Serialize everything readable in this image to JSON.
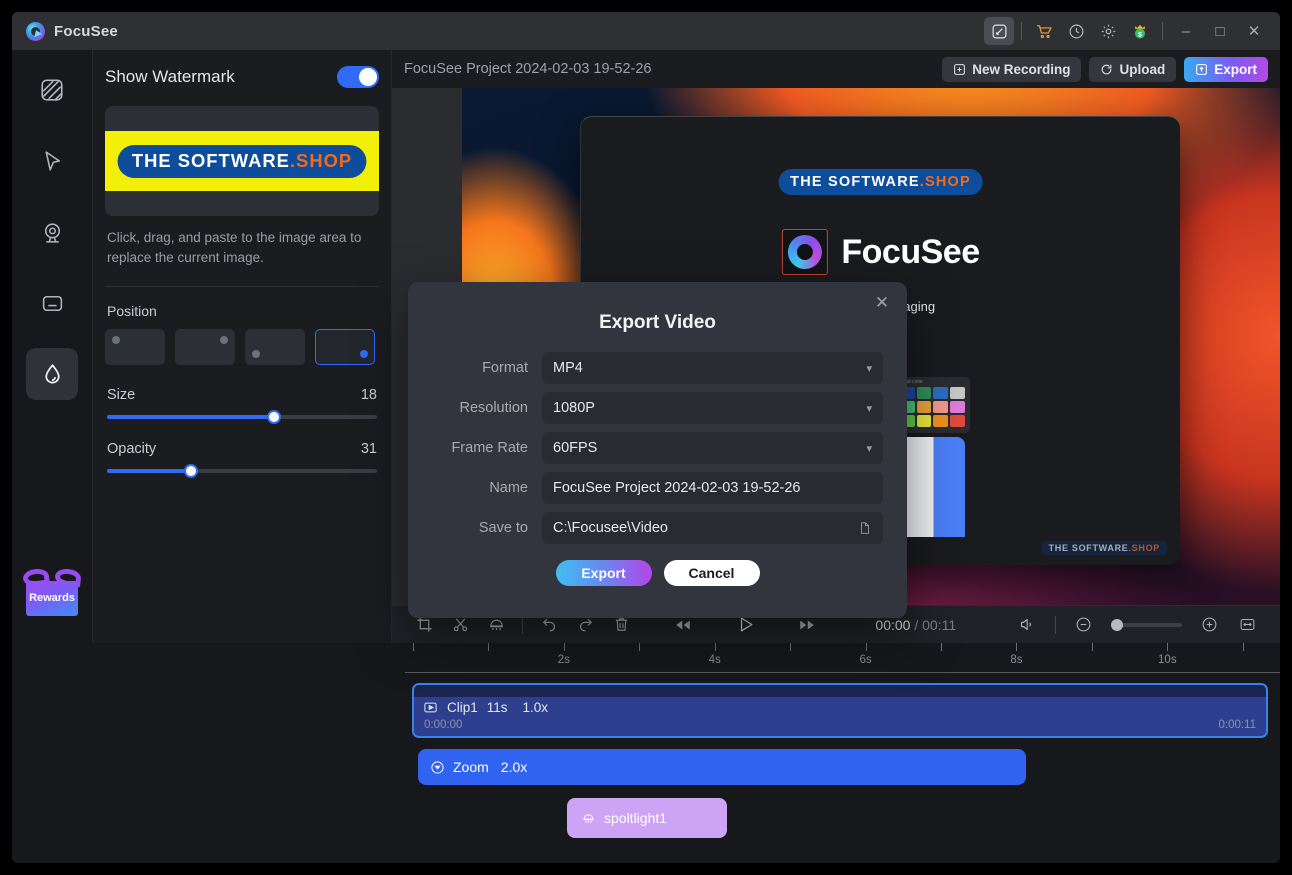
{
  "titlebar": {
    "app_name": "FocuSee",
    "icons": [
      "pen-edit-icon",
      "cart-icon",
      "clock-icon",
      "gear-icon",
      "crown-dollar-icon"
    ],
    "window_controls": {
      "minimize": "–",
      "maximize": "□",
      "close": "✕"
    }
  },
  "rail": {
    "items": [
      {
        "name": "background",
        "icon": "background-pattern-icon",
        "active": false
      },
      {
        "name": "cursor",
        "icon": "cursor-arrow-icon",
        "active": false
      },
      {
        "name": "webcam",
        "icon": "webcam-icon",
        "active": false
      },
      {
        "name": "subtitle",
        "icon": "subtitle-icon",
        "active": false
      },
      {
        "name": "watermark",
        "icon": "water-drop-icon",
        "active": true
      }
    ],
    "rewards_label": "Rewards"
  },
  "panel": {
    "title": "Show Watermark",
    "toggle_on": true,
    "watermark_text_white": "THE SOFTWARE",
    "watermark_text_orange": ".SHOP",
    "hint": "Click, drag, and paste to the image area to replace the current image.",
    "position_label": "Position",
    "positions": [
      {
        "name": "top-left",
        "selected": false
      },
      {
        "name": "top-right",
        "selected": false
      },
      {
        "name": "bottom-left",
        "selected": false
      },
      {
        "name": "bottom-right",
        "selected": true
      }
    ],
    "size_label": "Size",
    "size_value": "18",
    "size_percent": 62,
    "opacity_label": "Opacity",
    "opacity_value": "31",
    "opacity_percent": 31
  },
  "main_top": {
    "project_name": "FocuSee Project 2024-02-03 19-52-26",
    "new_recording": "New Recording",
    "upload": "Upload",
    "export": "Export"
  },
  "preview": {
    "watermark_white": "THE SOFTWARE",
    "watermark_orange": ".SHOP",
    "brand": "FocuSee",
    "tagline": "polished, engaging",
    "palette_caption": "Background color",
    "corner_watermark_white": "THE SOFTWARE",
    "corner_watermark_orange": ".SHOP",
    "swatch_colors": [
      "#1e5fbf",
      "#1a4a9e",
      "#2f8f5e",
      "#2a6fbf",
      "#c6c6c6",
      "#3fd0c0",
      "#44c77a",
      "#f0a23a",
      "#f09a8a",
      "#e07ad8",
      "#9fd8f5",
      "#63c94a",
      "#eaea3a",
      "#f0901e",
      "#e04a3a"
    ]
  },
  "playbar": {
    "tools": [
      "crop-icon",
      "scissors-cut-icon",
      "eraser-icon"
    ],
    "history": [
      "undo-icon",
      "redo-icon",
      "trash-delete-icon"
    ],
    "transport": [
      "rewind-icon",
      "play-icon",
      "fast-forward-icon"
    ],
    "current_time": "00:00",
    "separator": "/",
    "total_time": "00:11",
    "volume_icon": "speaker-volume-icon",
    "zoom_out_icon": "zoom-out-icon",
    "zoom_in_icon": "zoom-in-icon",
    "fit_icon": "fit-to-screen-icon",
    "zoom_percent": 0
  },
  "timeline": {
    "tick_labels": [
      "2s",
      "4s",
      "6s",
      "8s",
      "10s"
    ],
    "clip": {
      "icon": "video-clip-icon",
      "name": "Clip1",
      "duration": "11s",
      "speed": "1.0x",
      "start_time": "0:00:00",
      "end_time": "0:00:11"
    },
    "zoom_track": {
      "icon": "zoom-target-icon",
      "name": "Zoom",
      "scale": "2.0x"
    },
    "spotlight_track": {
      "icon": "spotlight-lamp-icon",
      "name": "spoltlight1"
    }
  },
  "modal": {
    "title": "Export Video",
    "close_icon": "close-icon",
    "fields": [
      {
        "label": "Format",
        "value": "MP4",
        "type": "select"
      },
      {
        "label": "Resolution",
        "value": "1080P",
        "type": "select"
      },
      {
        "label": "Frame Rate",
        "value": "60FPS",
        "type": "select"
      },
      {
        "label": "Name",
        "value": "FocuSee Project 2024-02-03 19-52-26",
        "type": "text"
      },
      {
        "label": "Save to",
        "value": "C:\\Focusee\\Video",
        "type": "path"
      }
    ],
    "export_button": "Export",
    "cancel_button": "Cancel"
  },
  "colors": {
    "accent_blue": "#2f6bf5",
    "watermark_yellow": "#f2ef08",
    "watermark_blue": "#0d4d9c",
    "watermark_orange": "#f26a1b",
    "spotlight_purple": "#cda4f5"
  }
}
